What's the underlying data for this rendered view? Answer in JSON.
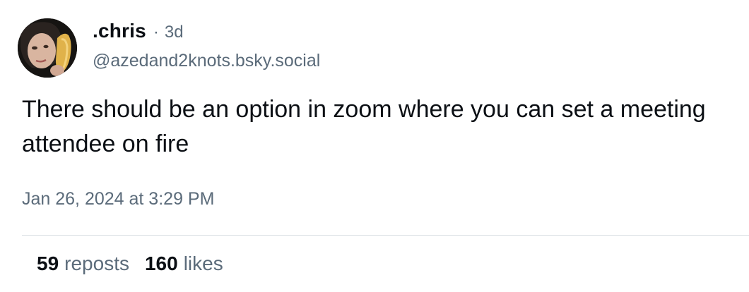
{
  "author": {
    "display_name": ".chris",
    "separator": "·",
    "age": "3d",
    "handle": "@azedand2knots.bsky.social"
  },
  "post": {
    "text": "There should be an option in zoom where you can set a meeting attendee on fire",
    "timestamp": "Jan 26, 2024 at 3:29 PM"
  },
  "stats": {
    "reposts_count": "59",
    "reposts_label": "reposts",
    "likes_count": "160",
    "likes_label": "likes"
  }
}
